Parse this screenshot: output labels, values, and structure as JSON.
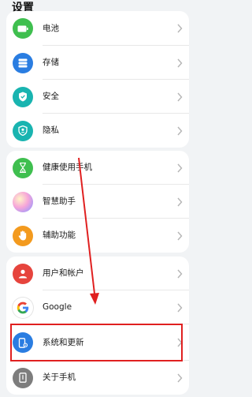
{
  "header": {
    "title": "设置"
  },
  "groups": [
    {
      "items": [
        {
          "id": "battery",
          "label": "电池",
          "icon": "battery-icon",
          "color": "#3fbf4f"
        },
        {
          "id": "storage",
          "label": "存储",
          "icon": "storage-icon",
          "color": "#2a7de1"
        },
        {
          "id": "security",
          "label": "安全",
          "icon": "shield-icon",
          "color": "#19b4b0"
        },
        {
          "id": "privacy",
          "label": "隐私",
          "icon": "privacy-icon",
          "color": "#19b4b0"
        }
      ]
    },
    {
      "items": [
        {
          "id": "digital-health",
          "label": "健康使用手机",
          "icon": "hourglass-icon",
          "color": "#3fbf4f"
        },
        {
          "id": "assistant",
          "label": "智慧助手",
          "icon": "assistant-orb-icon",
          "color": "#e98bd0"
        },
        {
          "id": "accessibility",
          "label": "辅助功能",
          "icon": "hand-icon",
          "color": "#f39a1e"
        }
      ]
    },
    {
      "items": [
        {
          "id": "accounts",
          "label": "用户和帐户",
          "icon": "user-icon",
          "color": "#e6443d"
        },
        {
          "id": "google",
          "label": "Google",
          "icon": "google-icon",
          "color": "#ffffff"
        },
        {
          "id": "system",
          "label": "系统和更新",
          "icon": "system-update-icon",
          "color": "#2a7de1"
        },
        {
          "id": "about",
          "label": "关于手机",
          "icon": "phone-icon",
          "color": "#7d7d7d"
        }
      ]
    }
  ],
  "annotation": {
    "highlight_color": "#e02020"
  }
}
